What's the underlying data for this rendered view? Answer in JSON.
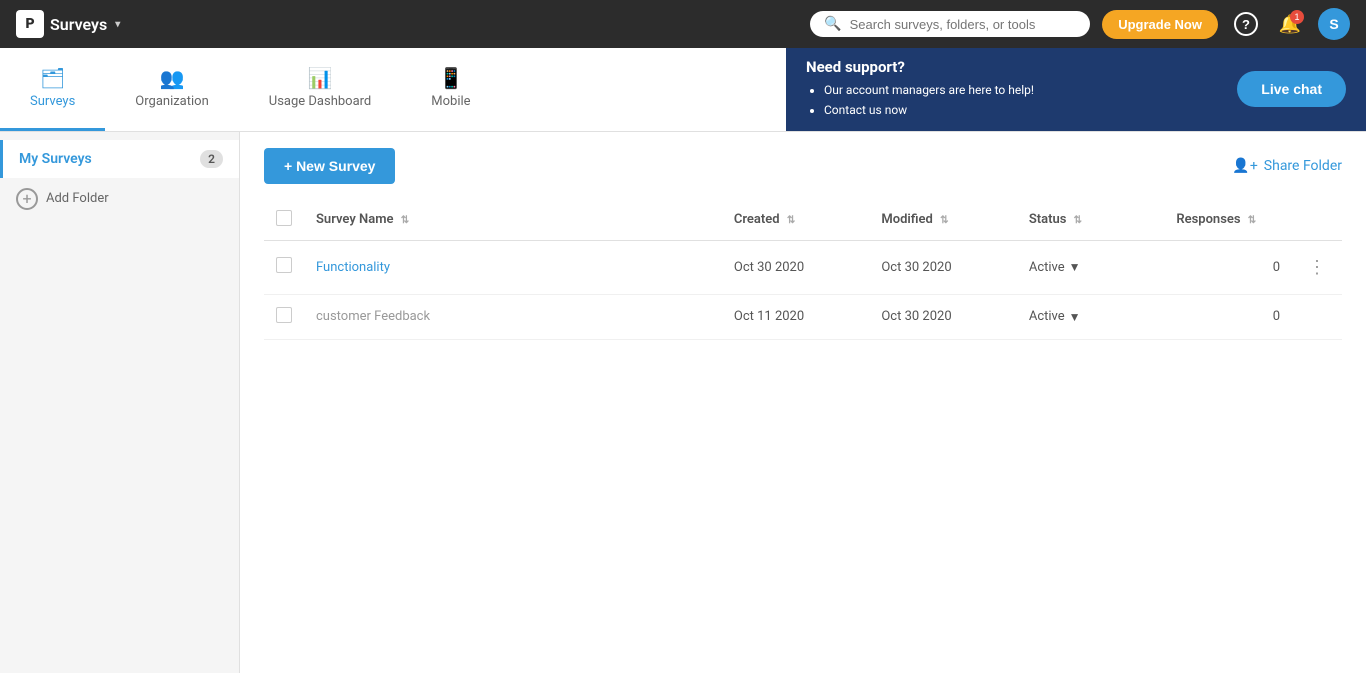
{
  "app": {
    "logo": "P",
    "title": "Surveys",
    "dropdown_arrow": "▾"
  },
  "topnav": {
    "search_placeholder": "Search surveys, folders, or tools",
    "upgrade_label": "Upgrade Now",
    "help_icon": "?",
    "notification_badge": "1",
    "avatar_label": "S"
  },
  "tabs": [
    {
      "id": "surveys",
      "label": "Surveys",
      "icon": "🗂",
      "active": true
    },
    {
      "id": "organization",
      "label": "Organization",
      "icon": "👥",
      "active": false
    },
    {
      "id": "usage-dashboard",
      "label": "Usage Dashboard",
      "icon": "📊",
      "active": false
    },
    {
      "id": "mobile",
      "label": "Mobile",
      "icon": "📱",
      "active": false
    }
  ],
  "support_banner": {
    "title": "Need support?",
    "bullet1": "Our account managers are here to help!",
    "bullet2": "Contact us now",
    "cta_label": "Live chat"
  },
  "sidebar": {
    "my_surveys_label": "My Surveys",
    "my_surveys_count": "2",
    "add_folder_label": "Add Folder"
  },
  "survey_list": {
    "new_survey_label": "+ New Survey",
    "share_folder_label": "Share Folder",
    "table": {
      "headers": [
        {
          "id": "name",
          "label": "Survey Name"
        },
        {
          "id": "created",
          "label": "Created"
        },
        {
          "id": "modified",
          "label": "Modified"
        },
        {
          "id": "status",
          "label": "Status"
        },
        {
          "id": "responses",
          "label": "Responses"
        }
      ],
      "rows": [
        {
          "id": 1,
          "name": "Functionality",
          "created": "Oct 30 2020",
          "modified": "Oct 30 2020",
          "status": "Active",
          "responses": "0",
          "highlight": false
        },
        {
          "id": 2,
          "name": "customer Feedback",
          "created": "Oct 11 2020",
          "modified": "Oct 30 2020",
          "status": "Active",
          "responses": "0",
          "highlight": true
        }
      ]
    }
  }
}
